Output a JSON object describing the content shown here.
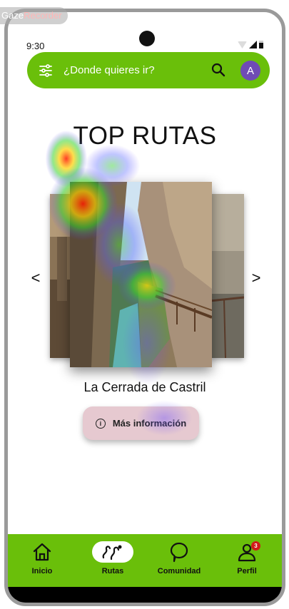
{
  "recorder": {
    "word_a": "Gaze",
    "word_b": "Recorder"
  },
  "status_bar": {
    "time": "9:30"
  },
  "search": {
    "placeholder": "¿Donde quieres ir?"
  },
  "user": {
    "avatar_letter": "A"
  },
  "page": {
    "title": "TOP RUTAS"
  },
  "carousel": {
    "prev_glyph": "<",
    "next_glyph": ">",
    "current_route": "La Cerrada de Castril"
  },
  "info_button": {
    "icon_glyph": "i",
    "label": "Más información"
  },
  "bottom_nav": {
    "items": [
      {
        "label": "Inicio",
        "icon": "home-icon"
      },
      {
        "label": "Rutas",
        "icon": "hiking-route-icon",
        "active": true
      },
      {
        "label": "Comunidad",
        "icon": "chat-bubble-icon"
      },
      {
        "label": "Perfil",
        "icon": "profile-icon",
        "badge": "3"
      }
    ]
  },
  "colors": {
    "brand_green": "#6abf0a",
    "avatar_purple": "#6f4bb5",
    "info_button_bg": "#e6c9d0",
    "badge_red": "#d11b1b"
  }
}
